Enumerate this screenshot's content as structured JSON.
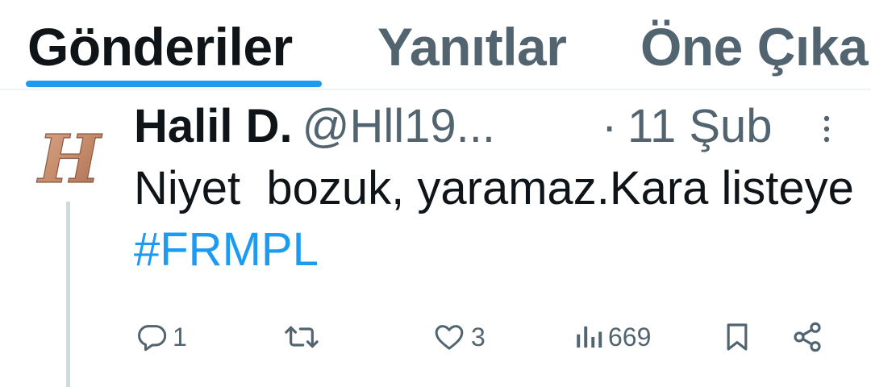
{
  "tabs": [
    {
      "label": "Gönderiler",
      "active": true
    },
    {
      "label": "Yanıtlar",
      "active": false
    },
    {
      "label": "Öne Çıka",
      "active": false
    }
  ],
  "colors": {
    "accent": "#1d9bf0",
    "text": "#0f1419",
    "muted": "#536471"
  },
  "tweet": {
    "author_name": "Halil D.",
    "author_handle": "@Hll19...",
    "dot": "·",
    "date": "11 Şub",
    "text_main": "Niyet  bozuk, yaramaz.Kara listeye ",
    "hashtag": "#FRMPL",
    "avatar_letter": "H"
  },
  "actions": {
    "reply_count": "1",
    "retweet_count": "",
    "like_count": "3",
    "views_count": "669"
  },
  "icons": [
    "more-vertical-icon",
    "reply-icon",
    "retweet-icon",
    "like-icon",
    "views-icon",
    "bookmark-icon",
    "share-icon"
  ]
}
